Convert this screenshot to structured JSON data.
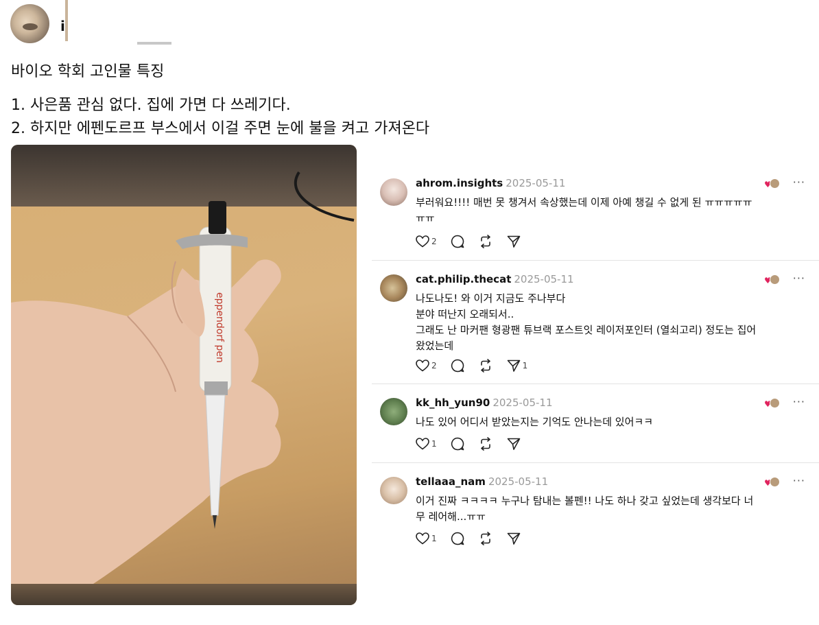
{
  "post": {
    "username_visible": "i",
    "title": "바이오 학회 고인물 특징",
    "line1": "1. 사은품 관심 없다. 집에 가면 다 쓰레기다.",
    "line2": "2. 하지만 에펜도르프 부스에서 이걸 주면 눈에 불을 켜고 가져온다",
    "photo_label": "eppendorf pen"
  },
  "comments": [
    {
      "username": "ahrom.insights",
      "date": "2025-05-11",
      "lines": [
        "부러워요!!!! 매번 못 챙겨서 속상했는데 이제 아예 챙길 수 없게 된 ㅠㅠㅠㅠㅠ",
        "ㅠㅠ"
      ],
      "likes": "2",
      "shares": ""
    },
    {
      "username": "cat.philip.thecat",
      "date": "2025-05-11",
      "lines": [
        "나도나도! 와 이거 지금도 주나부다",
        "분야 떠난지 오래되서..",
        "그래도 난 마커팬 형광팬 튜브랙 포스트잇 레이저포인터 (열쇠고리) 정도는 집어",
        "왔었는데"
      ],
      "likes": "2",
      "shares": "1"
    },
    {
      "username": "kk_hh_yun90",
      "date": "2025-05-11",
      "lines": [
        "나도 있어 어디서 받았는지는 기억도 안나는데 있어ㅋㅋ"
      ],
      "likes": "1",
      "shares": ""
    },
    {
      "username": "tellaaa_nam",
      "date": "2025-05-11",
      "lines": [
        "이거 진짜 ㅋㅋㅋㅋ 누구나 탐내는 볼펜!! 나도 하나 갖고 싶었는데 생각보다 너",
        "무 레어해...ㅠㅠ"
      ],
      "likes": "1",
      "shares": ""
    }
  ],
  "icons": {
    "like": "heart-outline-icon",
    "reply": "speech-bubble-icon",
    "repost": "repost-arrows-icon",
    "share": "paper-plane-icon",
    "more": "ellipsis-icon"
  },
  "more_glyph": "···",
  "colors": {
    "heart": "#e0245e",
    "date": "#999999",
    "divider": "#e3e3e3"
  }
}
